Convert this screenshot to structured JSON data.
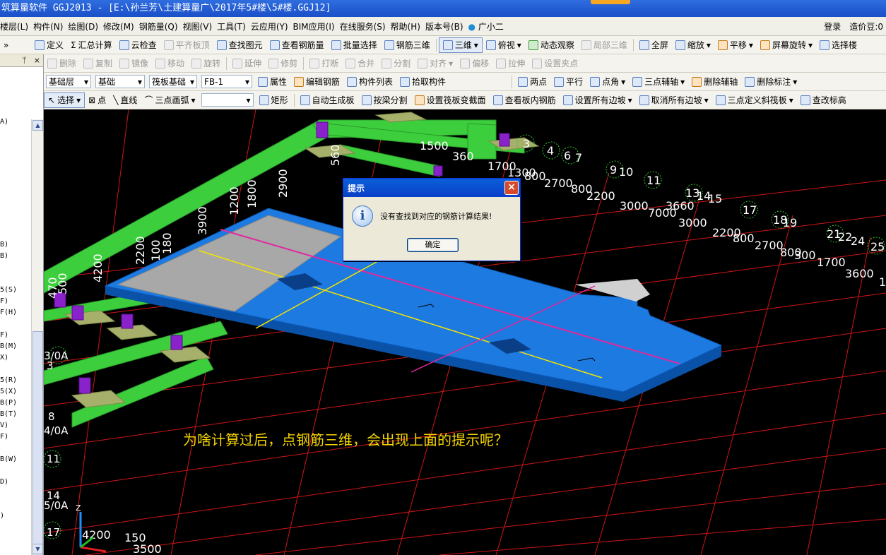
{
  "window": {
    "title": "筑算量软件 GGJ2013 - [E:\\孙兰芳\\土建算量广\\2017年5#楼\\5#楼.GGJ12]"
  },
  "menu": {
    "items": [
      "楼层(L)",
      "构件(N)",
      "绘图(D)",
      "修改(M)",
      "钢筋量(Q)",
      "视图(V)",
      "工具(T)",
      "云应用(Y)",
      "BIM应用(I)",
      "在线服务(S)",
      "帮助(H)",
      "版本号(B)",
      "广小二"
    ],
    "login": "登录",
    "balance": "造价豆:0"
  },
  "toolbar1": {
    "define": "定义",
    "sum_calc": "汇总计算",
    "cloud_check": "云检查",
    "flat_top": "平齐板顶",
    "find_element": "查找图元",
    "view_rebar": "查看钢筋量",
    "batch_select": "批量选择",
    "rebar_3d": "钢筋三维",
    "view_3d": "三维",
    "top_view": "俯视",
    "dynamic_view": "动态观察",
    "local_3d": "局部三维",
    "fullscreen": "全屏",
    "zoom": "缩放",
    "pan": "平移",
    "rotate_screen": "屏幕旋转",
    "select_layer": "选择楼"
  },
  "toolbar2": {
    "delete": "删除",
    "copy": "复制",
    "mirror": "镜像",
    "move": "移动",
    "rotate": "旋转",
    "extend": "延伸",
    "trim": "修剪",
    "break": "打断",
    "merge": "合并",
    "split": "分割",
    "align": "对齐",
    "offset": "偏移",
    "stretch": "拉伸",
    "set_grip": "设置夹点"
  },
  "toolbar3": {
    "floor": "基础层",
    "category": "基础",
    "type": "筏板基础",
    "member": "FB-1",
    "property": "属性",
    "edit_rebar": "编辑钢筋",
    "member_list": "构件列表",
    "pick_member": "拾取构件",
    "two_points": "两点",
    "parallel": "平行",
    "point_angle": "点角",
    "three_point_aux": "三点辅轴",
    "delete_aux": "删除辅轴",
    "delete_dim": "删除标注"
  },
  "toolbar4": {
    "select": "选择",
    "point": "点",
    "line": "直线",
    "three_point_arc": "三点画弧",
    "rect": "矩形",
    "auto_gen_slab": "自动生成板",
    "split_by_beam": "按梁分割",
    "set_slab_section": "设置筏板变截面",
    "view_slab_rebar": "查看板内钢筋",
    "set_all_slope": "设置所有边坡",
    "cancel_all_slope": "取消所有边坡",
    "three_point_slope": "三点定义斜筏板",
    "check_elevation": "查改标高"
  },
  "left_panel": {
    "pin": "ᛘ",
    "close": "×",
    "items": [
      "A)",
      "B)",
      "B)",
      "5(S)",
      "F)",
      "F(H)",
      "F)",
      "B(M)",
      "X)",
      "5(R)",
      "5(X)",
      "B(P)",
      "B(T)",
      "V)",
      "F)",
      "B(W)",
      "D)",
      ")"
    ]
  },
  "viewport": {
    "caption": "为啥计算过后，点钢筋三维，会出现上面的提示呢？",
    "dims": [
      "1500",
      "360",
      "560",
      "1700",
      "1300",
      "800",
      "2700",
      "800",
      "2200",
      "3000",
      "3660",
      "7000",
      "3000",
      "2200",
      "800",
      "2700",
      "800",
      "300",
      "1700",
      "3600",
      "2900",
      "1800",
      "1200",
      "3900",
      "2200",
      "100",
      "180",
      "4200",
      "470",
      "500",
      "4200",
      "150",
      "3500"
    ],
    "axis_labels": [
      "3",
      "4",
      "6",
      "7",
      "9",
      "10",
      "11",
      "13",
      "14",
      "15",
      "17",
      "18",
      "19",
      "21",
      "22",
      "24",
      "25",
      "1"
    ],
    "side_labels": [
      "3/0A",
      "3",
      "8",
      "4/0A",
      "11",
      "14",
      "5/0A",
      "17"
    ]
  },
  "dialog": {
    "title": "提示",
    "message": "没有查找到对应的钢筋计算结果!",
    "ok": "确定",
    "close": "×"
  }
}
